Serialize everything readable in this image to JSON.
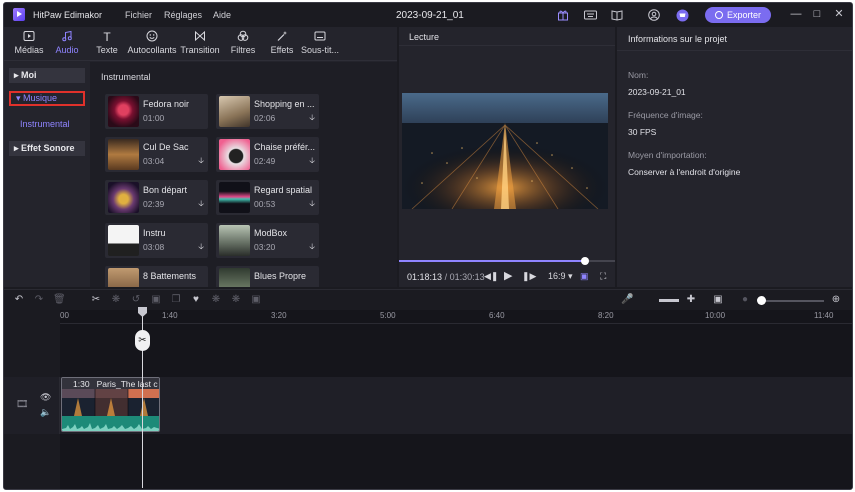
{
  "app": {
    "name": "HitPaw Edimakor",
    "menus": [
      "Fichier",
      "Réglages",
      "Aide"
    ],
    "project_title": "2023-09-21_01",
    "export_label": "Exporter"
  },
  "toolbar": [
    {
      "label": "Médias",
      "icon": "media-icon"
    },
    {
      "label": "Audio",
      "icon": "music-note-icon"
    },
    {
      "label": "Texte",
      "icon": "text-icon"
    },
    {
      "label": "Autocollants",
      "icon": "sticker-icon"
    },
    {
      "label": "Transition",
      "icon": "transition-icon"
    },
    {
      "label": "Filtres",
      "icon": "filter-icon"
    },
    {
      "label": "Effets",
      "icon": "magic-wand-icon"
    },
    {
      "label": "Sous-tit...",
      "icon": "subtitle-icon"
    }
  ],
  "categories": {
    "moi": "Moi",
    "musique": "Musique",
    "instrumental": "Instrumental",
    "effet_sonore": "Effet Sonore"
  },
  "music": {
    "section_title": "Instrumental",
    "tracks": [
      {
        "name": "Fedora noir",
        "duration": "01:00"
      },
      {
        "name": "Shopping en ...",
        "duration": "02:06"
      },
      {
        "name": "Cul De Sac",
        "duration": "03:04"
      },
      {
        "name": "Chaise préfér...",
        "duration": "02:49"
      },
      {
        "name": "Bon départ",
        "duration": "02:39"
      },
      {
        "name": "Regard spatial",
        "duration": "00:53"
      },
      {
        "name": "Instru",
        "duration": "03:08"
      },
      {
        "name": "ModBox",
        "duration": "03:20"
      },
      {
        "name": "8 Battements",
        "duration": ""
      },
      {
        "name": "Blues Propre",
        "duration": ""
      }
    ]
  },
  "preview": {
    "title": "Lecture",
    "current_time": "01:18:13",
    "total_time": "/ 01:30:13",
    "aspect_ratio": "16:9",
    "progress_fraction": 0.86
  },
  "project_info": {
    "title": "Informations sur le projet",
    "name_label": "Nom:",
    "name_value": "2023-09-21_01",
    "frame_rate_label": "Fréquence d'image:",
    "frame_rate_value": "30 FPS",
    "import_mode_label": "Moyen d'importation:",
    "import_mode_value": "Conserver à l'endroit d'origine"
  },
  "timeline": {
    "ruler_ticks": [
      "00",
      "1:40",
      "3:20",
      "5:00",
      "6:40",
      "8:20",
      "10:00",
      "11:40"
    ],
    "clip": {
      "duration": "1:30",
      "title": "Paris_The last c"
    }
  },
  "colors": {
    "accent": "#7b6cf0",
    "highlight_border": "#e0312b",
    "audio_wave": "#1d8a78"
  }
}
